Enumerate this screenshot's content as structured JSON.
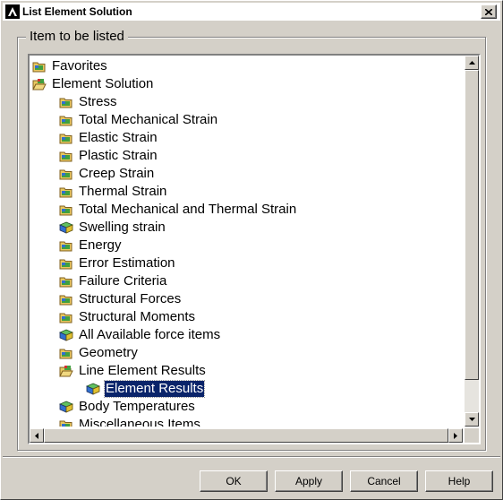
{
  "window": {
    "title": "List Element Solution"
  },
  "group": {
    "label": "Item to be listed"
  },
  "tree": {
    "items": [
      {
        "label": "Favorites",
        "level": 0,
        "icon": "folder-icon"
      },
      {
        "label": "Element Solution",
        "level": 0,
        "icon": "open-folder-icon"
      },
      {
        "label": "Stress",
        "level": 1,
        "icon": "folder-icon"
      },
      {
        "label": "Total Mechanical Strain",
        "level": 1,
        "icon": "folder-icon"
      },
      {
        "label": "Elastic Strain",
        "level": 1,
        "icon": "folder-icon"
      },
      {
        "label": "Plastic Strain",
        "level": 1,
        "icon": "folder-icon"
      },
      {
        "label": "Creep Strain",
        "level": 1,
        "icon": "folder-icon"
      },
      {
        "label": "Thermal Strain",
        "level": 1,
        "icon": "folder-icon"
      },
      {
        "label": "Total Mechanical and Thermal Strain",
        "level": 1,
        "icon": "folder-icon"
      },
      {
        "label": "Swelling strain",
        "level": 1,
        "icon": "cube-icon"
      },
      {
        "label": "Energy",
        "level": 1,
        "icon": "folder-icon"
      },
      {
        "label": "Error Estimation",
        "level": 1,
        "icon": "folder-icon"
      },
      {
        "label": "Failure Criteria",
        "level": 1,
        "icon": "folder-icon"
      },
      {
        "label": "Structural Forces",
        "level": 1,
        "icon": "folder-icon"
      },
      {
        "label": "Structural Moments",
        "level": 1,
        "icon": "folder-icon"
      },
      {
        "label": "All Available force items",
        "level": 1,
        "icon": "cube-icon"
      },
      {
        "label": "Geometry",
        "level": 1,
        "icon": "folder-icon"
      },
      {
        "label": "Line Element Results",
        "level": 1,
        "icon": "open-folder-icon"
      },
      {
        "label": "Element Results",
        "level": 2,
        "icon": "cube-icon",
        "selected": true
      },
      {
        "label": "Body Temperatures",
        "level": 1,
        "icon": "cube-icon"
      },
      {
        "label": "Miscellaneous Items",
        "level": 1,
        "icon": "folder-icon"
      }
    ]
  },
  "buttons": {
    "ok": "OK",
    "apply": "Apply",
    "cancel": "Cancel",
    "help": "Help"
  },
  "colors": {
    "selection": "#0a246a",
    "dialog": "#d4d0c8"
  }
}
